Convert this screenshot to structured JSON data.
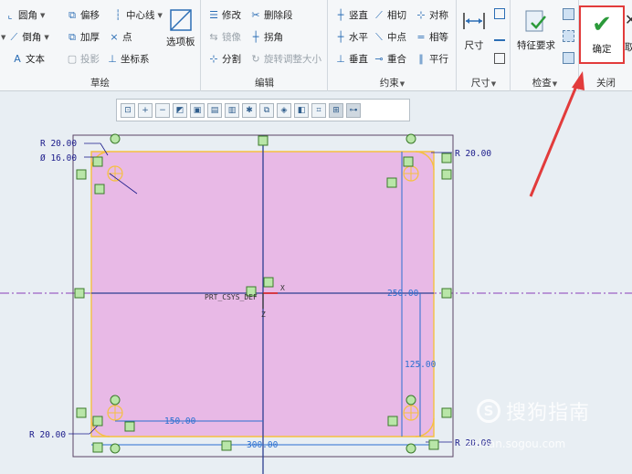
{
  "ribbon": {
    "sketch": {
      "label": "草绘",
      "items": [
        "圆角",
        "倒角",
        "文本",
        "偏移",
        "加厚",
        "投影",
        "中心线",
        "点",
        "坐标系"
      ],
      "palette": "选项板"
    },
    "edit": {
      "label": "编辑",
      "items": [
        "修改",
        "镜像",
        "分割",
        "删除段",
        "拐角",
        "旋转调整大小"
      ]
    },
    "constrain": {
      "label": "约束",
      "items": [
        "竖直",
        "水平",
        "垂直",
        "相切",
        "中点",
        "重合",
        "对称",
        "相等",
        "平行"
      ]
    },
    "dimension": {
      "label": "尺寸",
      "btn": "尺寸"
    },
    "inspect": {
      "label": "检查",
      "btn": "特征要求"
    },
    "close": {
      "label": "关闭",
      "ok": "确定",
      "cancel": "取"
    }
  },
  "sketch": {
    "dims": {
      "r_tl": "R 20.00",
      "dia": "Ø 16.00",
      "r_tr": "R 20.00",
      "r_bl": "R 20.00",
      "r_br": "R 20.00",
      "d150": "150.00",
      "d300": "300.00",
      "d250": "250.00",
      "d125": "125.00"
    },
    "csys": "PRT_CSYS_DEF",
    "x_axis": "X",
    "z_axis": "Z"
  },
  "watermark": {
    "text": "搜狗指南",
    "url": "zhinan.sogou.com"
  },
  "colors": {
    "fill": "#e8b9e6",
    "outline": "#f5c041",
    "sketch_line": "#2c3e90",
    "centerline": "#8a3fb8",
    "dimension": "#1a1a8a",
    "ok_border": "#e23b3b",
    "arrow": "#e23b3b"
  }
}
